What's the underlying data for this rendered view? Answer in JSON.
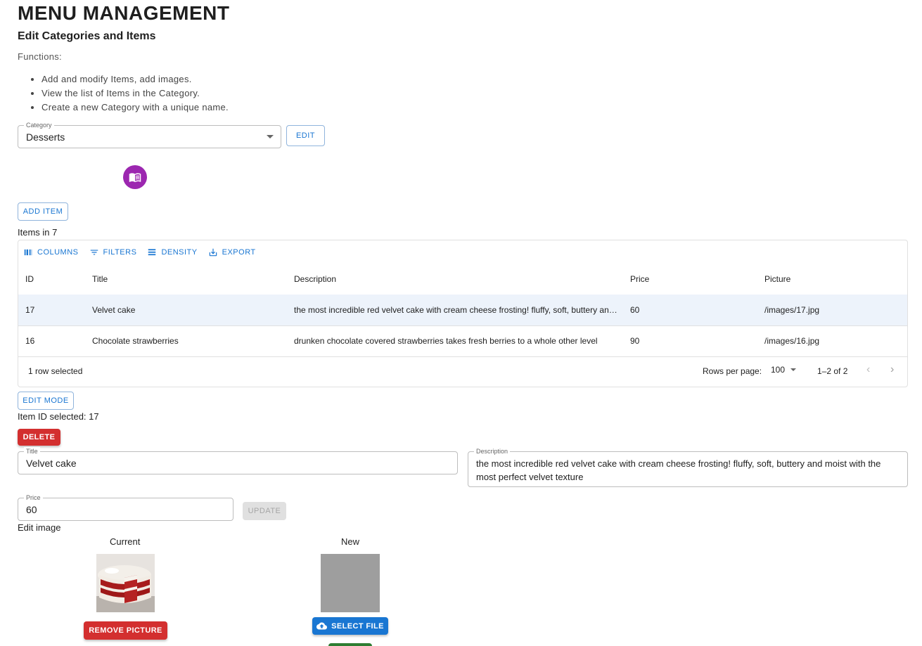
{
  "header": {
    "title": "MENU MANAGEMENT",
    "subtitle": "Edit Categories and Items",
    "functions_label": "Functions:",
    "functions": [
      "Add and modify Items, add images.",
      "View the list of Items in the Category.",
      "Create a new Category with a unique name."
    ]
  },
  "category": {
    "label": "Category",
    "value": "Desserts",
    "edit_label": "EDIT",
    "avatar_icon": "menu-book-icon",
    "avatar_color": "#9c27b0"
  },
  "add_item_label": "ADD ITEM",
  "items_heading": "Items in 7",
  "grid": {
    "toolbar": {
      "columns": "COLUMNS",
      "filters": "FILTERS",
      "density": "DENSITY",
      "export": "EXPORT"
    },
    "headers": {
      "id": "ID",
      "title": "Title",
      "description": "Description",
      "price": "Price",
      "picture": "Picture"
    },
    "rows": [
      {
        "id": "17",
        "title": "Velvet cake",
        "description": "the most incredible red velvet cake with cream cheese frosting! fluffy, soft, buttery an…",
        "price": "60",
        "picture": "/images/17.jpg",
        "selected": true
      },
      {
        "id": "16",
        "title": "Chocolate strawberries",
        "description": "drunken chocolate covered strawberries takes fresh berries to a whole other level",
        "price": "90",
        "picture": "/images/16.jpg",
        "selected": false
      }
    ],
    "footer": {
      "selected_text": "1 row selected",
      "rows_per_page_label": "Rows per page:",
      "rows_per_page_value": "100",
      "range": "1–2 of 2"
    }
  },
  "edit_mode_label": "EDIT MODE",
  "item_selected_text": "Item ID selected: 17",
  "delete_label": "DELETE",
  "form": {
    "title_label": "Title",
    "title_value": "Velvet cake",
    "description_label": "Description",
    "description_value": "the most incredible red velvet cake with cream cheese frosting! fluffy, soft, buttery and moist with the most perfect velvet texture",
    "price_label": "Price",
    "price_value": "60",
    "update_label": "UPDATE"
  },
  "image_edit": {
    "heading": "Edit image",
    "current_label": "Current",
    "new_label": "New",
    "remove_label": "REMOVE PICTURE",
    "select_file_label": "SELECT FILE"
  },
  "colors": {
    "primary": "#1976d2",
    "danger": "#d32f2f",
    "selected_row": "#edf3fb",
    "placeholder_gray": "#9e9e9e",
    "success": "#2e7d32"
  }
}
